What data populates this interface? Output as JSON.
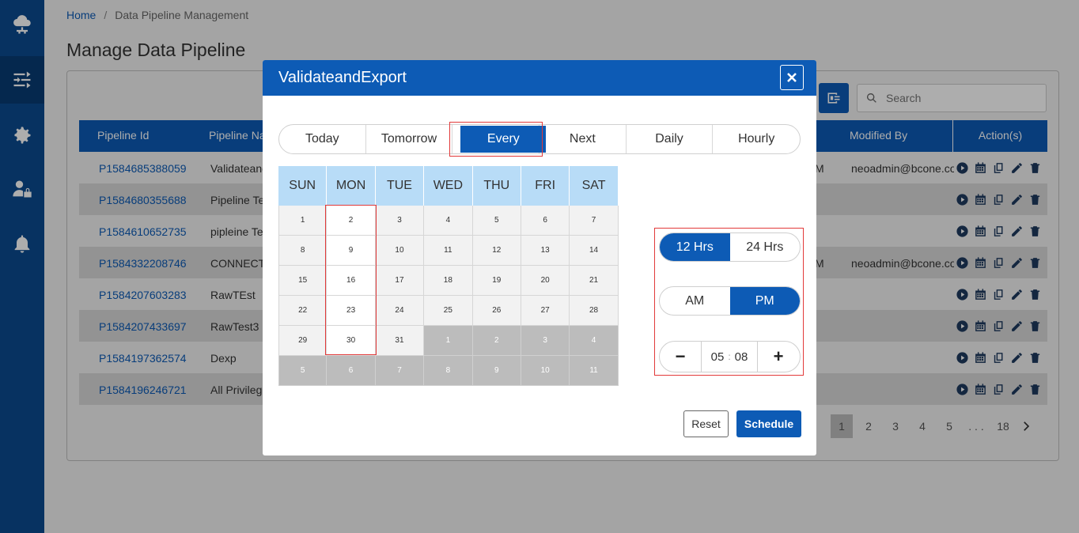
{
  "breadcrumb": {
    "home": "Home",
    "separator": "/",
    "current": "Data Pipeline Management"
  },
  "page_title": "Manage Data Pipeline",
  "search": {
    "placeholder": "Search"
  },
  "table": {
    "headers": {
      "pipeline_id": "Pipeline Id",
      "pipeline_name": "Pipeline Na",
      "modified_by": "Modified By",
      "actions": "Action(s)"
    },
    "rows": [
      {
        "id": "P1584685388059",
        "name": "Validateand",
        "mod": "M",
        "modified_by": "neoadmin@bcone.co"
      },
      {
        "id": "P1584680355688",
        "name": "Pipeline Te",
        "mod": "",
        "modified_by": ""
      },
      {
        "id": "P1584610652735",
        "name": "pipleine Te",
        "mod": "",
        "modified_by": ""
      },
      {
        "id": "P1584332208746",
        "name": "CONNECTI",
        "mod": "M",
        "modified_by": "neoadmin@bcone.co"
      },
      {
        "id": "P1584207603283",
        "name": "RawTEst",
        "mod": "",
        "modified_by": ""
      },
      {
        "id": "P1584207433697",
        "name": "RawTest3",
        "mod": "",
        "modified_by": ""
      },
      {
        "id": "P1584197362574",
        "name": "Dexp",
        "mod": "",
        "modified_by": ""
      },
      {
        "id": "P1584196246721",
        "name": "All Privilege",
        "mod": "",
        "modified_by": ""
      }
    ]
  },
  "pagination": {
    "pages": [
      "1",
      "2",
      "3",
      "4",
      "5",
      ". . .",
      "18"
    ],
    "current": "1"
  },
  "modal": {
    "title": "ValidateandExport",
    "tabs": [
      "Today",
      "Tomorrow",
      "Every",
      "Next",
      "Daily",
      "Hourly"
    ],
    "selected_tab": "Every",
    "weekdays": [
      "SUN",
      "MON",
      "TUE",
      "WED",
      "THU",
      "FRI",
      "SAT"
    ],
    "weeks": [
      [
        "1",
        "2",
        "3",
        "4",
        "5",
        "6",
        "7"
      ],
      [
        "8",
        "9",
        "10",
        "11",
        "12",
        "13",
        "14"
      ],
      [
        "15",
        "16",
        "17",
        "18",
        "19",
        "20",
        "21"
      ],
      [
        "22",
        "23",
        "24",
        "25",
        "26",
        "27",
        "28"
      ],
      [
        "29",
        "30",
        "31",
        "1",
        "2",
        "3",
        "4"
      ],
      [
        "5",
        "6",
        "7",
        "8",
        "9",
        "10",
        "11"
      ]
    ],
    "selected_weekday": "MON",
    "time_format": {
      "options": [
        "12 Hrs",
        "24 Hrs"
      ],
      "selected": "12 Hrs"
    },
    "meridiem": {
      "options": [
        "AM",
        "PM"
      ],
      "selected": "PM"
    },
    "time": {
      "hour": "05",
      "minute": "08",
      "decrement": "−",
      "increment": "+"
    },
    "reset_label": "Reset",
    "schedule_label": "Schedule"
  },
  "colors": {
    "primary": "#0d5bb5",
    "sidebar": "#0b4a8f",
    "highlight": "#e23a3a",
    "weekday_header": "#b8dcf7"
  }
}
